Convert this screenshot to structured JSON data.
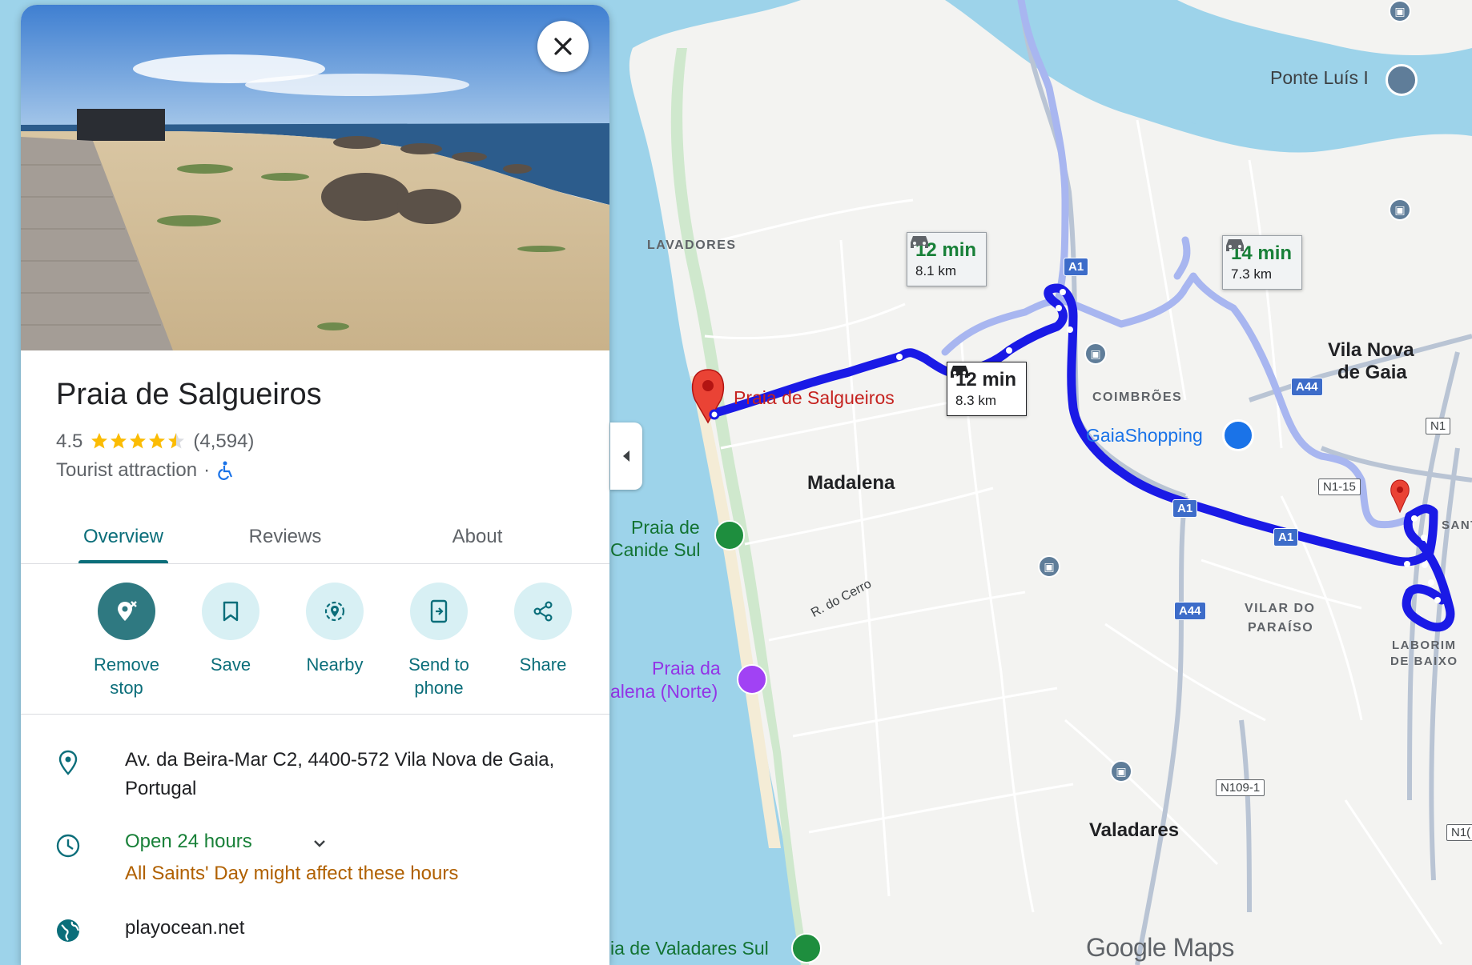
{
  "panel": {
    "title": "Praia de Salgueiros",
    "rating": "4.5",
    "review_count": "(4,594)",
    "stars_value": 4.5,
    "category": "Tourist attraction",
    "category_separator": "·",
    "tabs": [
      {
        "label": "Overview",
        "active": true
      },
      {
        "label": "Reviews",
        "active": false
      },
      {
        "label": "About",
        "active": false
      }
    ],
    "actions": [
      {
        "label": "Remove stop",
        "icon": "remove-stop-icon"
      },
      {
        "label": "Save",
        "icon": "bookmark-icon"
      },
      {
        "label": "Nearby",
        "icon": "nearby-icon"
      },
      {
        "label": "Send to phone",
        "icon": "send-to-phone-icon"
      },
      {
        "label": "Share",
        "icon": "share-icon"
      }
    ],
    "address": "Av. da Beira-Mar C2, 4400-572 Vila Nova de Gaia, Portugal",
    "hours_status": "Open 24 hours",
    "hours_notice": "All Saints' Day might affect these hours",
    "website": "playocean.net"
  },
  "map": {
    "routes": [
      {
        "time": "12 min",
        "distance": "8.1 km",
        "type": "alternate"
      },
      {
        "time": "12 min",
        "distance": "8.3 km",
        "type": "primary"
      },
      {
        "time": "14 min",
        "distance": "7.3 km",
        "type": "alternate"
      }
    ],
    "labels": {
      "lavadores": "LAVADORES",
      "destination": "Praia de Salgueiros",
      "madalena": "Madalena",
      "coimbroes": "COIMBRÕES",
      "gaiashopping": "GaiaShopping",
      "vila_nova_1": "Vila Nova",
      "vila_nova_2": "de Gaia",
      "ponte_luis": "Ponte Luís I",
      "praia_canide_1": "Praia de",
      "praia_canide_2": "Canide Sul",
      "r_do_cerro": "R. do Cerro",
      "praia_madalena_1": "Praia da",
      "praia_madalena_2": "alena (Norte)",
      "vilar_1": "VILAR DO",
      "vilar_2": "PARAÍSO",
      "laborim_1": "LABORIM",
      "laborim_2": "DE BAIXO",
      "valadares": "Valadares",
      "praia_valadares": "ia de Valadares Sul",
      "sant": "SANT",
      "logo": "Google Maps"
    },
    "shields": {
      "a1": "A1",
      "a44": "A44",
      "n1": "N1",
      "n1_15": "N1-15",
      "n109_1": "N109-1",
      "n1_edge": "N1("
    },
    "colors": {
      "water": "#9dd3ea",
      "land": "#f3f3f1",
      "route_primary": "#1a1ae6",
      "route_alt": "#a8b6f0",
      "marker": "#ea4335",
      "accent": "#0b6e7a"
    }
  }
}
